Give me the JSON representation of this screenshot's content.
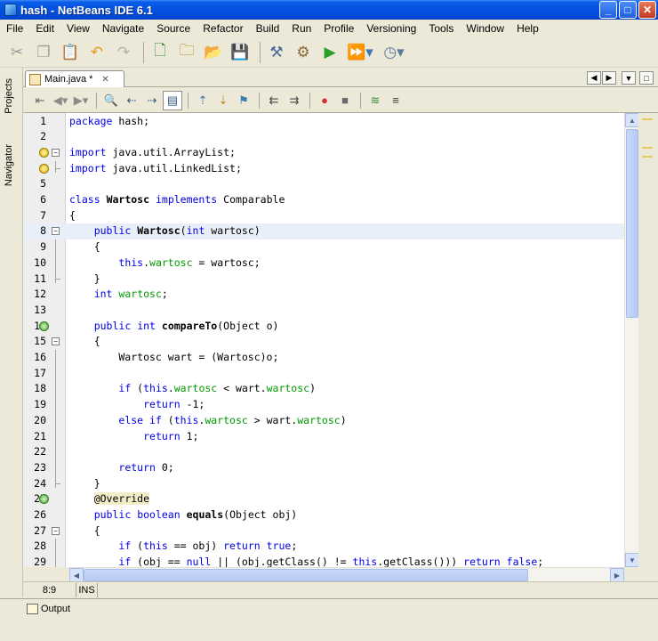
{
  "window": {
    "title": "hash - NetBeans IDE 6.1",
    "minimize": "_",
    "maximize": "□",
    "close": "✕"
  },
  "menu": [
    "File",
    "Edit",
    "View",
    "Navigate",
    "Source",
    "Refactor",
    "Build",
    "Run",
    "Profile",
    "Versioning",
    "Tools",
    "Window",
    "Help"
  ],
  "side_tabs": {
    "projects": "Projects",
    "navigator": "Navigator"
  },
  "editor_tab": {
    "label": "Main.java *",
    "close": "✕"
  },
  "status": {
    "position": "8:9",
    "mode": "INS"
  },
  "output_tab": "Output",
  "code_lines": [
    {
      "n": "1",
      "html": "<span class='kw'>package</span> hash;"
    },
    {
      "n": "2",
      "html": ""
    },
    {
      "n": "3",
      "html": "<span class='kw'>import</span> java.util.ArrayList;"
    },
    {
      "n": "4",
      "html": "<span class='kw'>import</span> java.util.LinkedList;"
    },
    {
      "n": "5",
      "html": ""
    },
    {
      "n": "6",
      "html": "<span class='kw'>class</span> <span class='bold'>Wartosc</span> <span class='kw'>implements</span> Comparable"
    },
    {
      "n": "7",
      "html": "{"
    },
    {
      "n": "8",
      "html": "    <span class='kw'>public</span> <span class='bold'>Wartosc</span>(<span class='kw'>int</span> wartosc)"
    },
    {
      "n": "9",
      "html": "    {"
    },
    {
      "n": "10",
      "html": "        <span class='kw'>this</span>.<span class='fld'>wartosc</span> = wartosc;"
    },
    {
      "n": "11",
      "html": "    }"
    },
    {
      "n": "12",
      "html": "    <span class='kw'>int</span> <span class='fld'>wartosc</span>;"
    },
    {
      "n": "13",
      "html": ""
    },
    {
      "n": "14",
      "html": "    <span class='kw'>public</span> <span class='kw'>int</span> <span class='bold'>compareTo</span>(Object o)"
    },
    {
      "n": "15",
      "html": "    {"
    },
    {
      "n": "16",
      "html": "        Wartosc wart = (Wartosc)o;"
    },
    {
      "n": "17",
      "html": ""
    },
    {
      "n": "18",
      "html": "        <span class='kw'>if</span> (<span class='kw'>this</span>.<span class='fld'>wartosc</span> &lt; wart.<span class='fld'>wartosc</span>)"
    },
    {
      "n": "19",
      "html": "            <span class='kw'>return</span> -1;"
    },
    {
      "n": "20",
      "html": "        <span class='kw'>else if</span> (<span class='kw'>this</span>.<span class='fld'>wartosc</span> &gt; wart.<span class='fld'>wartosc</span>)"
    },
    {
      "n": "21",
      "html": "            <span class='kw'>return</span> 1;"
    },
    {
      "n": "22",
      "html": ""
    },
    {
      "n": "23",
      "html": "        <span class='kw'>return</span> 0;"
    },
    {
      "n": "24",
      "html": "    }"
    },
    {
      "n": "25",
      "html": "    <span class='ann-bg'>@Override</span>"
    },
    {
      "n": "26",
      "html": "    <span class='kw'>public</span> <span class='kw'>boolean</span> <span class='bold'>equals</span>(Object obj)"
    },
    {
      "n": "27",
      "html": "    {"
    },
    {
      "n": "28",
      "html": "        <span class='kw'>if</span> (<span class='kw'>this</span> == obj) <span class='kw'>return</span> <span class='kw'>true</span>;"
    },
    {
      "n": "29",
      "html": "        <span class='kw'>if</span> (obj == <span class='kw'>null</span> || (obj.getClass() != <span class='kw'>this</span>.getClass())) <span class='kw'>return</span> <span class='kw'>false</span>;"
    }
  ],
  "colors": {
    "keyword": "#0000e6",
    "field": "#009900",
    "current_line": "#e9eff8"
  }
}
